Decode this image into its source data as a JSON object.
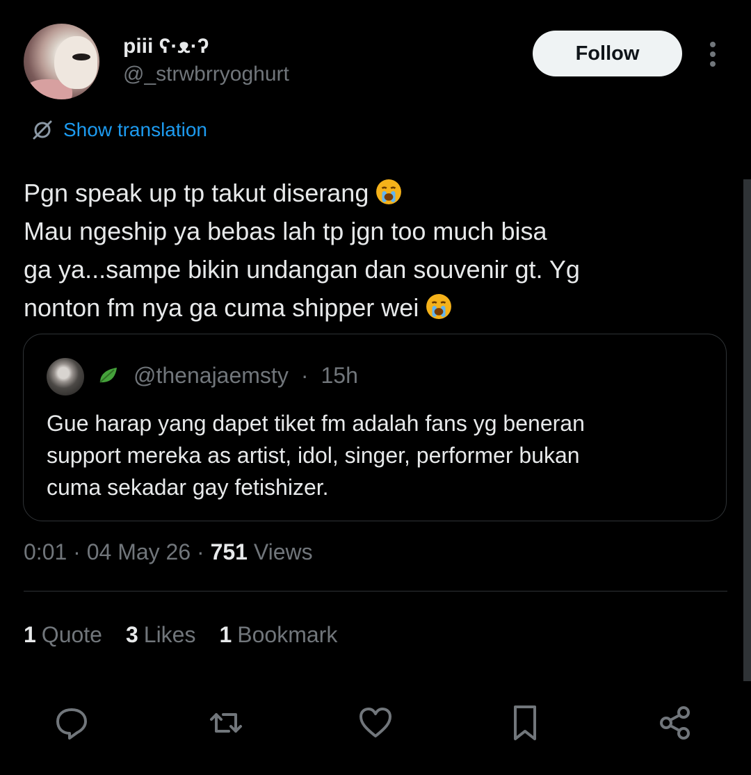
{
  "author": {
    "display_name": "piii ʕ·ᴥ·ʔ",
    "handle": "@_strwbrryoghurt",
    "avatar_icon": "user-avatar-photo"
  },
  "follow_label": "Follow",
  "more_icon": "vertical-ellipsis-icon",
  "translation": {
    "label": "Show translation",
    "icon": "globe-translate-icon",
    "color": "#1d9bf0"
  },
  "tweet": {
    "lines": [
      "Pgn speak up tp takut diserang",
      "Mau ngeship ya bebas lah tp jgn too much bisa",
      "ga ya...sampe bikin undangan dan souvenir gt. Yg",
      "nonton fm nya ga cuma shipper wei"
    ],
    "emoji_name": "loudly-crying-face"
  },
  "quoted": {
    "handle": "@thenajaemsty",
    "time": "15h",
    "leaf_icon": "green-leaf-icon",
    "lines": [
      "Gue harap yang dapet tiket fm adalah fans yg beneran",
      "support mereka as artist, idol, singer, performer bukan",
      "cuma sekadar gay fetishizer."
    ]
  },
  "meta": {
    "time": "0:01",
    "date": "04 May 26",
    "views_count": "751",
    "views_label": "Views"
  },
  "stats": [
    {
      "count": "1",
      "label": "Quote"
    },
    {
      "count": "3",
      "label": "Likes"
    },
    {
      "count": "1",
      "label": "Bookmark"
    }
  ],
  "actions": [
    "reply-icon",
    "retweet-icon",
    "like-icon",
    "bookmark-icon",
    "share-icon"
  ],
  "colors": {
    "background": "#000000",
    "primary_text": "#e7e9ea",
    "secondary_text": "#71767b",
    "border": "#2f3336",
    "accent": "#1d9bf0"
  }
}
